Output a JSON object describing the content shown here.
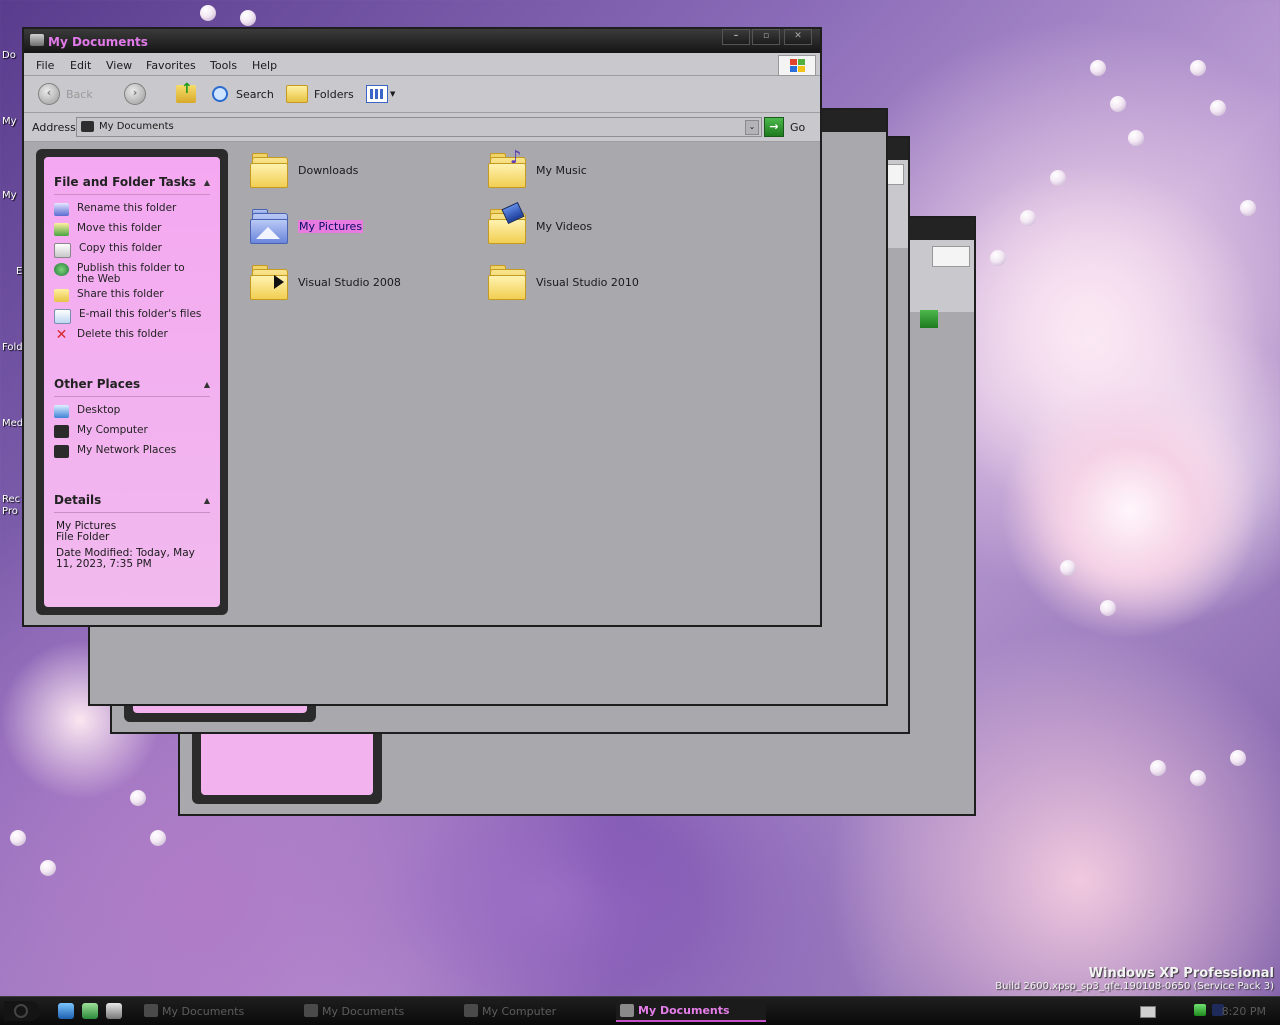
{
  "desktop": {
    "labels": [
      "Do",
      "My",
      "My",
      "E",
      "Fold",
      "Med",
      "Rec",
      "Pro"
    ],
    "watermark": {
      "line1": "Windows XP Professional",
      "line2": "Build 2600.xpsp_sp3_qfe.190108-0650 (Service Pack 3)"
    }
  },
  "window": {
    "title": "My Documents",
    "controls": [
      "–",
      "▫",
      "✕"
    ],
    "menu": [
      "File",
      "Edit",
      "View",
      "Favorites",
      "Tools",
      "Help"
    ],
    "toolbar": {
      "back": "Back",
      "search": "Search",
      "folders": "Folders"
    },
    "address": {
      "label": "Address",
      "value": "My Documents",
      "go": "Go"
    }
  },
  "taskpane": {
    "file_tasks": {
      "title": "File and Folder Tasks",
      "items": [
        {
          "label": "Rename this folder",
          "icon": "rename-icon"
        },
        {
          "label": "Move this folder",
          "icon": "move-icon"
        },
        {
          "label": "Copy this folder",
          "icon": "copy-icon"
        },
        {
          "label": "Publish this folder to the Web",
          "icon": "globe-icon"
        },
        {
          "label": "Share this folder",
          "icon": "share-icon"
        },
        {
          "label": "E-mail this folder's files",
          "icon": "email-icon"
        },
        {
          "label": "Delete this folder",
          "icon": "delete-icon"
        }
      ]
    },
    "other_places": {
      "title": "Other Places",
      "items": [
        {
          "label": "Desktop",
          "icon": "desktop-icon"
        },
        {
          "label": "My Computer",
          "icon": "computer-icon"
        },
        {
          "label": "My Network Places",
          "icon": "network-icon"
        }
      ]
    },
    "details": {
      "title": "Details",
      "name": "My Pictures",
      "type": "File Folder",
      "modified": "Date Modified: Today, May 11, 2023, 7:35 PM"
    }
  },
  "folders": [
    {
      "label": "Downloads",
      "icon": "folder-icon",
      "selected": false
    },
    {
      "label": "My Music",
      "icon": "music-folder-icon",
      "selected": false
    },
    {
      "label": "My Pictures",
      "icon": "pictures-folder-icon",
      "selected": true
    },
    {
      "label": "My Videos",
      "icon": "videos-folder-icon",
      "selected": false
    },
    {
      "label": "Visual Studio 2008",
      "icon": "folder-icon",
      "selected": false
    },
    {
      "label": "Visual Studio 2010",
      "icon": "folder-icon",
      "selected": false
    }
  ],
  "taskbar": {
    "buttons": [
      {
        "label": "My Documents",
        "active": false
      },
      {
        "label": "My Documents",
        "active": false
      },
      {
        "label": "My Computer",
        "active": false
      },
      {
        "label": "My Documents",
        "active": true
      }
    ],
    "clock": "8:20 PM"
  },
  "colors": {
    "accent_pink": "#f4a8f1",
    "title_text": "#e07ae8",
    "window_body": "#a9a8ad"
  }
}
